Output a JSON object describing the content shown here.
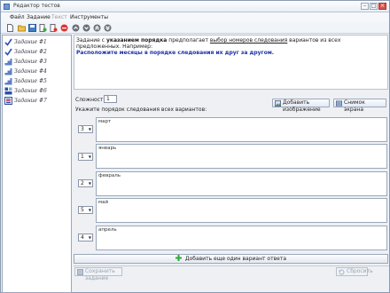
{
  "window": {
    "title": "Редактор тестов"
  },
  "menu": {
    "file": "Файл",
    "task": "Задание",
    "text": "Текст",
    "tools": "Инструменты"
  },
  "tasks": [
    {
      "label": "Задание #1",
      "icon": "checkmark-icon"
    },
    {
      "label": "Задание #2",
      "icon": "checkmark-icon"
    },
    {
      "label": "Задание #3",
      "icon": "staircase-icon"
    },
    {
      "label": "Задание #4",
      "icon": "staircase-icon"
    },
    {
      "label": "Задание #5",
      "icon": "staircase-icon"
    },
    {
      "label": "Задание #6",
      "icon": "blocks-icon"
    },
    {
      "label": "Задание #7",
      "icon": "list-order-icon"
    }
  ],
  "question": {
    "line1_a": "Задание с ",
    "line1_b": "указанием порядка",
    "line1_c": " предполагает ",
    "line1_d": "выбор номеров следования",
    "line1_e": " вариантов из всех предложенных. Например:",
    "line2": "Расположите месяцы в порядке следования их друг за другом."
  },
  "difficulty": {
    "label": "Сложность:",
    "value": "1"
  },
  "order_label": "Укажите порядок следования всех вариантов:",
  "buttons": {
    "add_image": "Добавить изображение",
    "screenshot": "Снимок экрана",
    "add_answer": "Добавить еще один вариант ответа",
    "save_task": "Сохранить задание",
    "reset": "Сбросить"
  },
  "answers": [
    {
      "order": "3",
      "text": "март"
    },
    {
      "order": "1",
      "text": "январь"
    },
    {
      "order": "2",
      "text": "февраль"
    },
    {
      "order": "5",
      "text": "май"
    },
    {
      "order": "4",
      "text": "апрель"
    }
  ],
  "colors": {
    "accent": "#1a2fa6",
    "check": "#2a4fb0"
  }
}
